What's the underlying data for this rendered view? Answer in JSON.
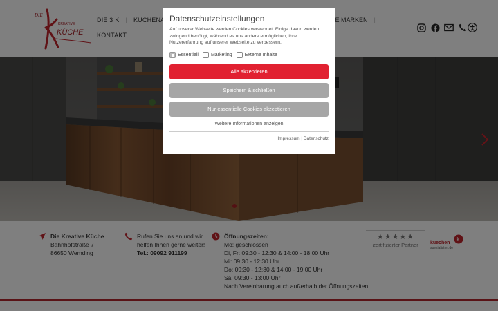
{
  "header": {
    "logo_text_small": "DIE",
    "logo_text_sub": "KREATIVE",
    "logo_text_main": "KÜCHE",
    "nav": {
      "row1": [
        "DIE 3 K",
        "KÜCHENAUSSTE"
      ],
      "row1_right": "RE MARKEN",
      "row2": [
        "KONTAKT"
      ]
    },
    "icons": [
      "instagram-icon",
      "facebook-icon",
      "mail-icon",
      "phone-icon"
    ],
    "accessibility_icon": "accessibility-icon"
  },
  "info": {
    "address": {
      "title": "Die Kreative Küche",
      "street": "Bahnhofstraße 7",
      "city": "86650 Wemding"
    },
    "contact": {
      "line1": "Rufen Sie uns an und wir",
      "line2": "helfen Ihnen gerne weiter!",
      "phone": "Tel.: 09092 911199"
    },
    "hours": {
      "title": "Öffnungszeiten:",
      "lines": [
        "Mo: geschlossen",
        "Di, Fr: 09:30 - 12:30 & 14:00 - 18:00 Uhr",
        "Mi: 09:30 - 12:30 Uhr",
        "Do: 09:30 - 12:30 & 14:00 - 19:00 Uhr",
        "Sa: 09:30 - 13:00 Uhr",
        "Nach Vereinbarung auch außerhalb der Öffnungszeiten."
      ]
    },
    "partner": {
      "stars": "★★★★★",
      "label": "zertifizierter Partner"
    },
    "ks_logo": {
      "line1": "kuechen",
      "line2": "spezialisten.de"
    }
  },
  "modal": {
    "title": "Datenschutzeinstellungen",
    "text": "Auf unserer Webseite werden Cookies verwendet. Einige davon werden zwingend benötigt, während es uns andere ermöglichen, Ihre Nutzererfahrung auf unserer Webseite zu verbessern.",
    "checkboxes": [
      {
        "label": "Essentiell",
        "checked": true
      },
      {
        "label": "Marketing",
        "checked": false
      },
      {
        "label": "Externe Inhalte",
        "checked": false
      }
    ],
    "accept_all": "Alle akzeptieren",
    "save_close": "Speichern & schließen",
    "essential_only": "Nur essentielle Cookies akzeptieren",
    "more_info": "Weitere Informationen anzeigen",
    "link_impressum": "Impressum",
    "link_sep": "|",
    "link_datenschutz": "Datenschutz"
  },
  "colors": {
    "accent": "#e12131",
    "brand_red": "#b3262d",
    "button_grey": "#a6a6a6"
  }
}
